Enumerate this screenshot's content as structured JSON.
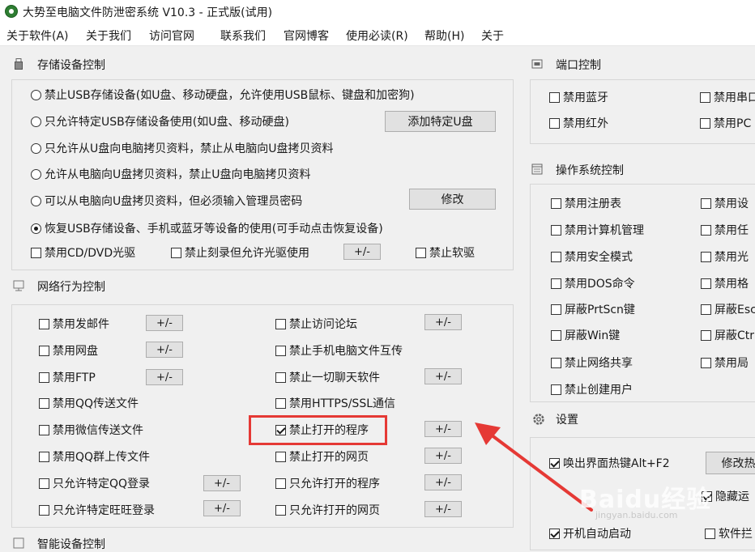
{
  "app": {
    "title": "大势至电脑文件防泄密系统 V10.3 - 正式版(试用)",
    "icon": "app-logo-icon"
  },
  "menu": [
    "关于软件(A)",
    "关于我们",
    "访问官网",
    "联系我们",
    "官网博客",
    "使用必读(R)",
    "帮助(H)",
    "关于"
  ],
  "storage": {
    "title": "存储设备控制",
    "icon": "usb-icon",
    "radios": [
      {
        "label": "禁止USB存储设备(如U盘、移动硬盘，允许使用USB鼠标、键盘和加密狗)",
        "checked": false
      },
      {
        "label": "只允许特定USB存储设备使用(如U盘、移动硬盘)",
        "checked": false
      },
      {
        "label": "只允许从U盘向电脑拷贝资料，禁止从电脑向U盘拷贝资料",
        "checked": false
      },
      {
        "label": "允许从电脑向U盘拷贝资料，禁止U盘向电脑拷贝资料",
        "checked": false
      },
      {
        "label": "可以从电脑向U盘拷贝资料，但必须输入管理员密码",
        "checked": false
      },
      {
        "label": "恢复USB存储设备、手机或蓝牙等设备的使用(可手动点击恢复设备)",
        "checked": true
      }
    ],
    "add_usb_button": "添加特定U盘",
    "modify_button": "修改",
    "checkboxes": [
      {
        "label": "禁用CD/DVD光驱",
        "checked": false
      },
      {
        "label": "禁止刻录但允许光驱使用",
        "checked": false
      },
      {
        "label": "禁止软驱",
        "checked": false
      }
    ],
    "pm_button": "+/-"
  },
  "network": {
    "title": "网络行为控制",
    "icon": "network-icon",
    "left": [
      {
        "label": "禁用发邮件",
        "checked": false,
        "pm": "+/-"
      },
      {
        "label": "禁用网盘",
        "checked": false,
        "pm": "+/-"
      },
      {
        "label": "禁用FTP",
        "checked": false,
        "pm": "+/-"
      },
      {
        "label": "禁用QQ传送文件",
        "checked": false,
        "pm": ""
      },
      {
        "label": "禁用微信传送文件",
        "checked": false,
        "pm": ""
      },
      {
        "label": "禁用QQ群上传文件",
        "checked": false,
        "pm": ""
      },
      {
        "label": "只允许特定QQ登录",
        "checked": false,
        "pm": "+/-"
      },
      {
        "label": "只允许特定旺旺登录",
        "checked": false,
        "pm": "+/-"
      }
    ],
    "right": [
      {
        "label": "禁止访问论坛",
        "checked": false,
        "pm": "+/-"
      },
      {
        "label": "禁止手机电脑文件互传",
        "checked": false,
        "pm": ""
      },
      {
        "label": "禁止一切聊天软件",
        "checked": false,
        "pm": "+/-"
      },
      {
        "label": "禁用HTTPS/SSL通信",
        "checked": false,
        "pm": ""
      },
      {
        "label": "禁止打开的程序",
        "checked": true,
        "pm": "+/-"
      },
      {
        "label": "禁止打开的网页",
        "checked": false,
        "pm": "+/-"
      },
      {
        "label": "只允许打开的程序",
        "checked": false,
        "pm": "+/-"
      },
      {
        "label": "只允许打开的网页",
        "checked": false,
        "pm": "+/-"
      }
    ]
  },
  "smart": {
    "title": "智能设备控制",
    "icon": "smart-device-icon"
  },
  "port": {
    "title": "端口控制",
    "icon": "port-icon",
    "items": [
      {
        "label": "禁用蓝牙",
        "checked": false
      },
      {
        "label": "禁用串口",
        "checked": false
      },
      {
        "label": "禁用红外",
        "checked": false
      },
      {
        "label": "禁用PC",
        "checked": false
      }
    ]
  },
  "os": {
    "title": "操作系统控制",
    "icon": "os-window-icon",
    "left": [
      {
        "label": "禁用注册表",
        "checked": false
      },
      {
        "label": "禁用计算机管理",
        "checked": false
      },
      {
        "label": "禁用安全模式",
        "checked": false
      },
      {
        "label": "禁用DOS命令",
        "checked": false
      },
      {
        "label": "屏蔽PrtScn键",
        "checked": false
      },
      {
        "label": "屏蔽Win键",
        "checked": false
      },
      {
        "label": "禁止网络共享",
        "checked": false
      },
      {
        "label": "禁止创建用户",
        "checked": false
      }
    ],
    "right": [
      {
        "label": "禁用设",
        "checked": false
      },
      {
        "label": "禁用任",
        "checked": false
      },
      {
        "label": "禁用光",
        "checked": false
      },
      {
        "label": "禁用格",
        "checked": false
      },
      {
        "label": "屏蔽Esc",
        "checked": false
      },
      {
        "label": "屏蔽Ctr",
        "checked": false
      },
      {
        "label": "禁用局",
        "checked": false
      }
    ]
  },
  "settings": {
    "title": "设置",
    "icon": "gear-icon",
    "hotkey": {
      "label": "唤出界面热键Alt+F2",
      "checked": true
    },
    "modify_hotkey_button": "修改热",
    "hide": {
      "label": "隐藏运",
      "checked": true
    },
    "autostart": {
      "label": "开机自动启动",
      "checked": true
    },
    "software": {
      "label": "软件拦",
      "checked": false
    }
  },
  "annotation": {
    "color": "#e53935",
    "icon": "red-arrow-icon"
  },
  "watermark": {
    "text": "Baidu经验",
    "subtext": "jingyan.baidu.com"
  }
}
